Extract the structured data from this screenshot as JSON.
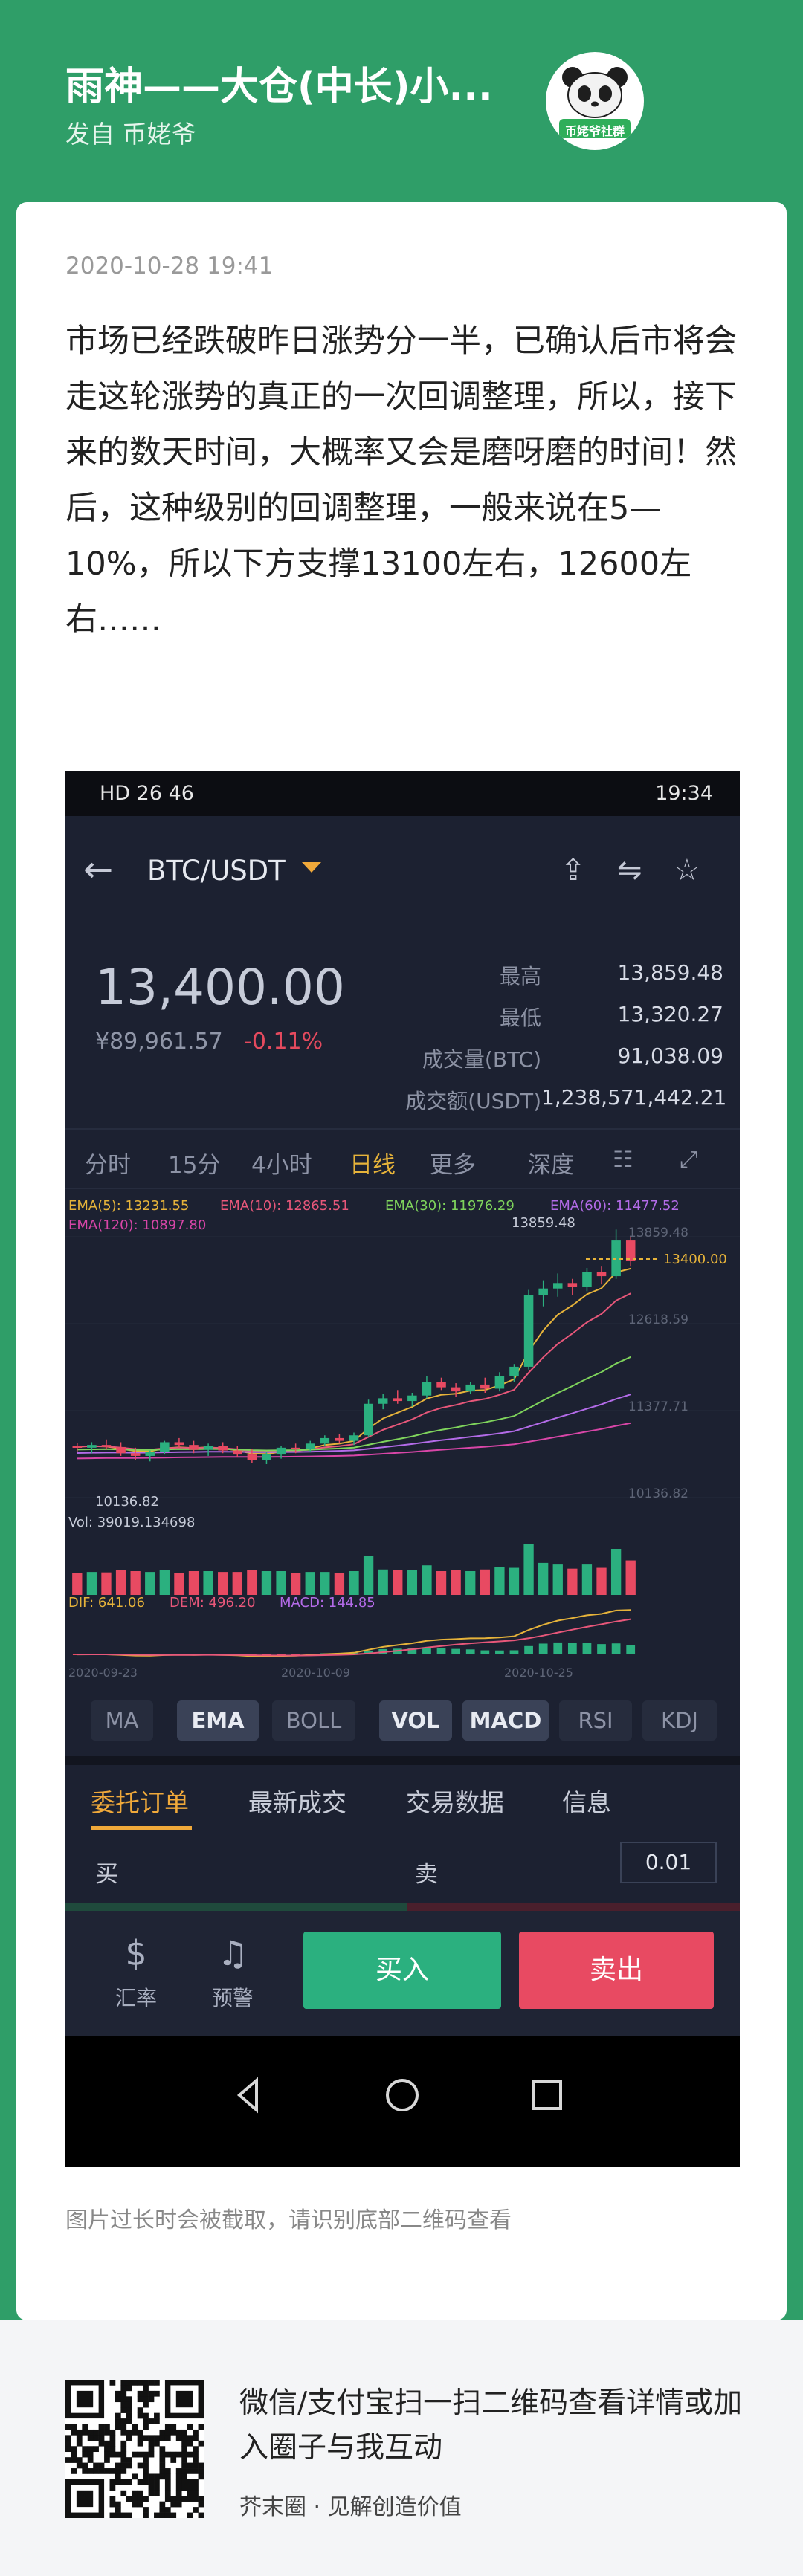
{
  "header": {
    "title": "雨神——大仓(中长)小...",
    "subtitle": "发自 币姥爷",
    "avatar_text": "币姥爷社群"
  },
  "post": {
    "date": "2020-10-28 19:41",
    "body": "市场已经跌破昨日涨势分一半，已确认后市将会走这轮涨势的真正的一次回调整理，所以，接下来的数天时间，大概率又会是磨呀磨的时间！然后，这种级别的回调整理，一般来说在5—10%，所以下方支撑13100左右，12600左右……",
    "truncation_note": "图片过长时会被截取，请识别底部二维码查看"
  },
  "screenshot": {
    "status_bar": {
      "left": "HD 26 46",
      "time": "19:34"
    },
    "pair": "BTC/USDT",
    "price": "13,400.00",
    "price_cny": "¥89,961.57",
    "change": "-0.11%",
    "stats": [
      {
        "label": "最高",
        "value": "13,859.48"
      },
      {
        "label": "最低",
        "value": "13,320.27"
      },
      {
        "label": "成交量(BTC)",
        "value": "91,038.09"
      },
      {
        "label": "成交额(USDT)",
        "value": "1,238,571,442.21"
      }
    ],
    "timeframes": [
      "分时",
      "15分",
      "4小时",
      "日线",
      "更多",
      "深度"
    ],
    "active_timeframe": "日线",
    "indicators": [
      "MA",
      "EMA",
      "BOLL",
      "VOL",
      "MACD",
      "RSI",
      "KDJ"
    ],
    "order_tabs": [
      "委托订单",
      "最新成交",
      "交易数据",
      "信息"
    ],
    "buy_label": "买",
    "sell_label": "卖",
    "qty_value": "0.01",
    "actions": {
      "rate": "汇率",
      "alert": "预警",
      "buy": "买入",
      "sell": "卖出"
    }
  },
  "chart_data": {
    "type": "candlestick",
    "legend": {
      "ema5": "EMA(5): 13231.55",
      "ema10": "EMA(10): 12865.51",
      "ema30": "EMA(30): 11976.29",
      "ema60": "EMA(60): 11477.52",
      "ema120": "EMA(120): 10897.80"
    },
    "y_ticks": [
      "13859.48",
      "12618.59",
      "11377.71",
      "10136.82"
    ],
    "ylim": [
      10136.82,
      13859.48
    ],
    "high_label": "13859.48",
    "low_label": "10136.82",
    "last_price_label": "13400.00",
    "x_ticks": [
      "2020-09-23",
      "2020-10-09",
      "2020-10-25"
    ],
    "volume_label": "Vol: 39019.134698",
    "macd_legend": {
      "dif": "DIF: 641.06",
      "dem": "DEM: 496.20",
      "macd": "MACD: 144.85"
    },
    "candles": [
      [
        10700,
        10750,
        10620,
        10680
      ],
      [
        10680,
        10760,
        10600,
        10720
      ],
      [
        10720,
        10800,
        10650,
        10690
      ],
      [
        10690,
        10760,
        10560,
        10600
      ],
      [
        10600,
        10680,
        10500,
        10560
      ],
      [
        10560,
        10640,
        10480,
        10620
      ],
      [
        10620,
        10780,
        10580,
        10760
      ],
      [
        10760,
        10820,
        10680,
        10720
      ],
      [
        10720,
        10780,
        10600,
        10650
      ],
      [
        10650,
        10740,
        10560,
        10710
      ],
      [
        10710,
        10760,
        10600,
        10640
      ],
      [
        10640,
        10700,
        10540,
        10580
      ],
      [
        10580,
        10660,
        10460,
        10500
      ],
      [
        10500,
        10620,
        10440,
        10580
      ],
      [
        10580,
        10700,
        10520,
        10680
      ],
      [
        10680,
        10740,
        10600,
        10660
      ],
      [
        10660,
        10780,
        10620,
        10740
      ],
      [
        10740,
        10860,
        10700,
        10820
      ],
      [
        10820,
        10880,
        10740,
        10780
      ],
      [
        10780,
        10900,
        10720,
        10860
      ],
      [
        10860,
        11380,
        10840,
        11320
      ],
      [
        11320,
        11460,
        11240,
        11400
      ],
      [
        11400,
        11520,
        11320,
        11360
      ],
      [
        11360,
        11480,
        11280,
        11440
      ],
      [
        11440,
        11720,
        11400,
        11640
      ],
      [
        11640,
        11700,
        11520,
        11560
      ],
      [
        11560,
        11620,
        11420,
        11500
      ],
      [
        11500,
        11640,
        11460,
        11600
      ],
      [
        11600,
        11700,
        11480,
        11540
      ],
      [
        11540,
        11780,
        11500,
        11720
      ],
      [
        11720,
        11900,
        11640,
        11860
      ],
      [
        11860,
        12980,
        11820,
        12900
      ],
      [
        12900,
        13120,
        12740,
        13000
      ],
      [
        13000,
        13220,
        12880,
        13080
      ],
      [
        13080,
        13140,
        12900,
        13020
      ],
      [
        13020,
        13300,
        12960,
        13240
      ],
      [
        13240,
        13320,
        13060,
        13180
      ],
      [
        13180,
        13860,
        13140,
        13700
      ],
      [
        13700,
        13760,
        13320,
        13400
      ]
    ]
  }
}
